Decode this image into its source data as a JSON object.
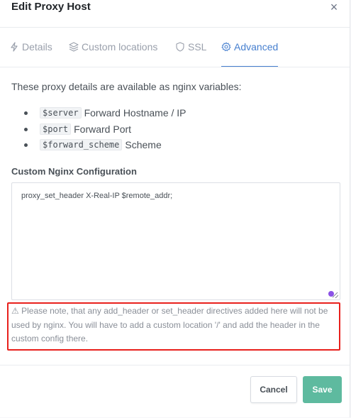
{
  "modal": {
    "title": "Edit Proxy Host",
    "close_symbol": "×"
  },
  "tabs": [
    {
      "label": "Details",
      "icon": "bolt-icon",
      "active": false
    },
    {
      "label": "Custom locations",
      "icon": "layers-icon",
      "active": false
    },
    {
      "label": "SSL",
      "icon": "shield-icon",
      "active": false
    },
    {
      "label": "Advanced",
      "icon": "gear-icon",
      "active": true
    }
  ],
  "advanced": {
    "intro": "These proxy details are available as nginx variables:",
    "variables": [
      {
        "code": "$server",
        "desc": "Forward Hostname / IP"
      },
      {
        "code": "$port",
        "desc": "Forward Port"
      },
      {
        "code": "$forward_scheme",
        "desc": "Scheme"
      }
    ],
    "config_label": "Custom Nginx Configuration",
    "config_value": "proxy_set_header X-Real-IP $remote_addr;",
    "note_icon": "⚠",
    "note": "Please note, that any add_header or set_header directives added here will not be used by nginx. You will have to add a custom location '/' and add the header in the custom config there."
  },
  "footer": {
    "cancel_label": "Cancel",
    "save_label": "Save"
  },
  "colors": {
    "accent": "#467fcf",
    "save": "#5eba9f",
    "highlight": "#e8201c"
  }
}
